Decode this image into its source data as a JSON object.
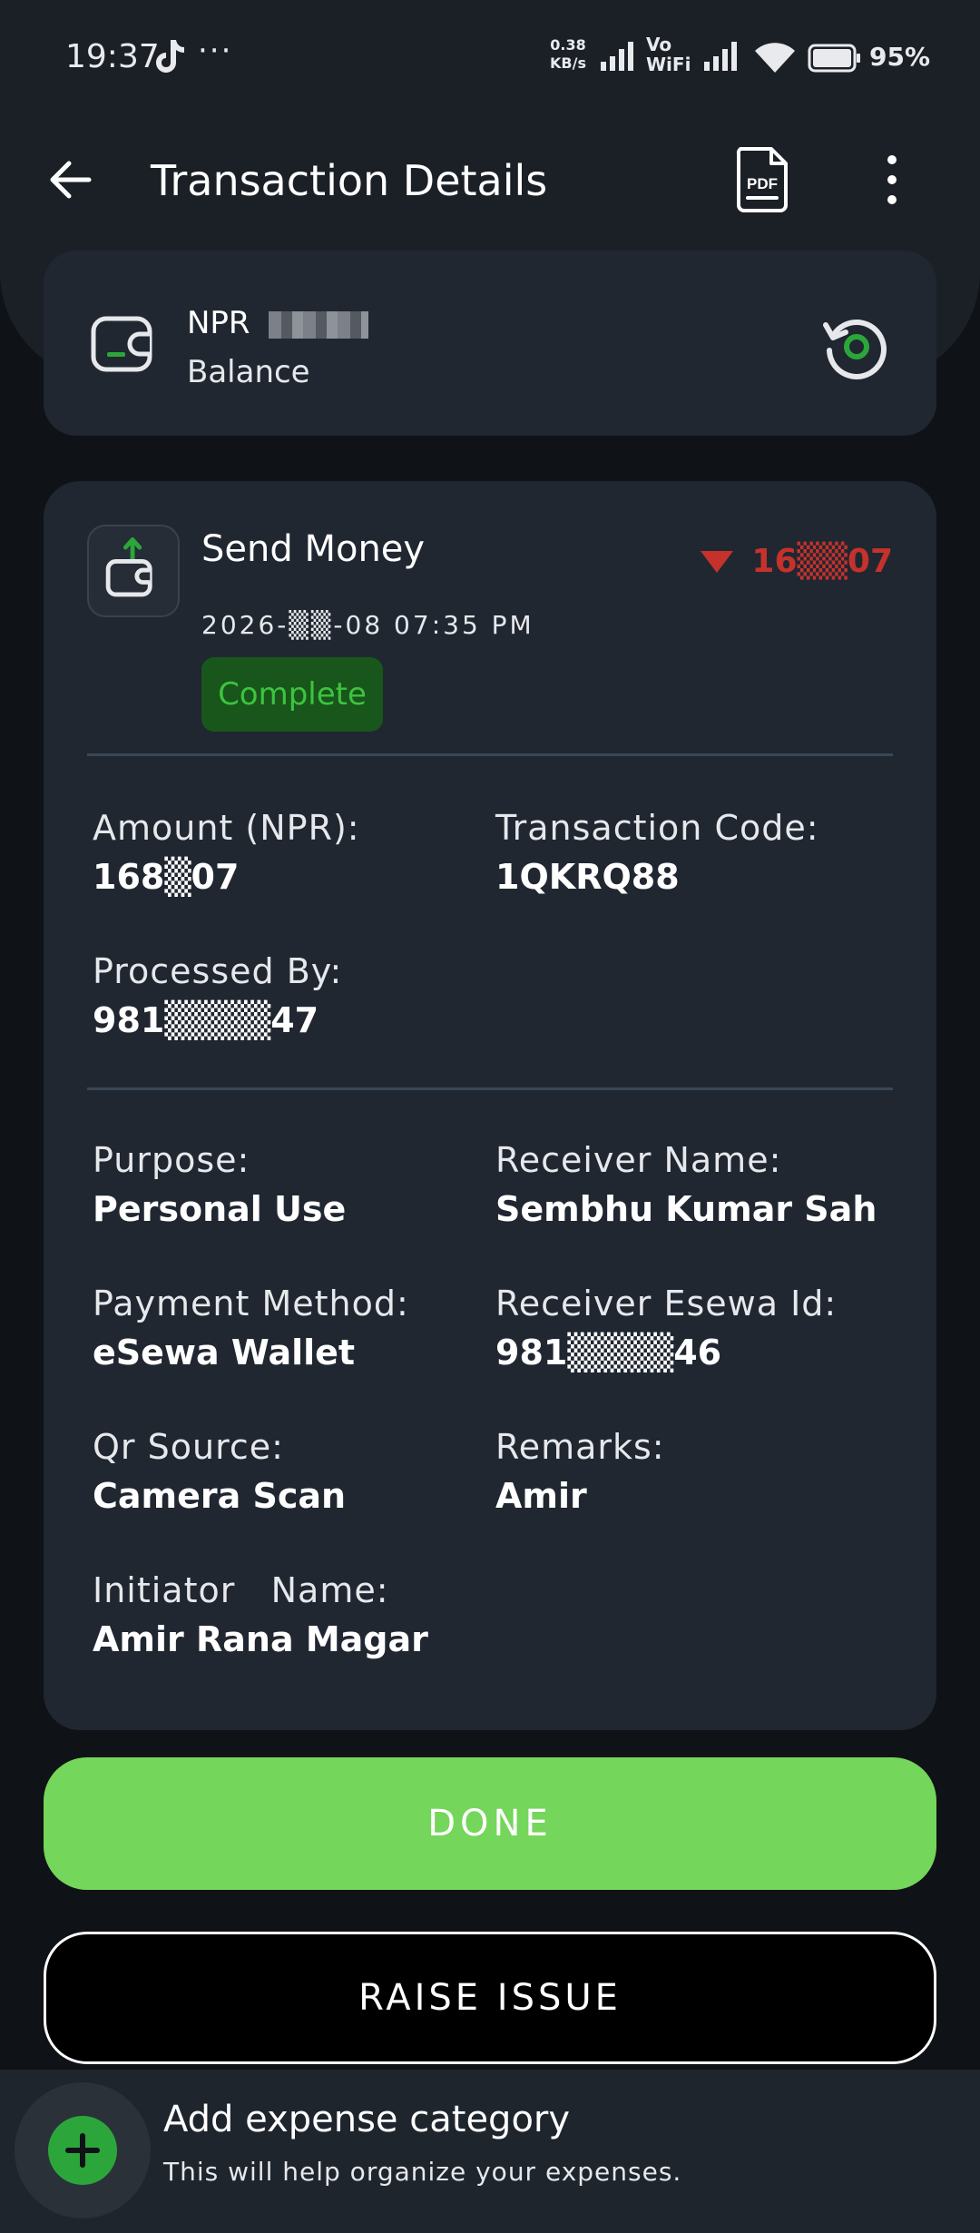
{
  "status_bar": {
    "time": "19:37",
    "dots": "···",
    "speed_value": "0.38",
    "speed_unit": "KB/s",
    "vowifi_top": "Vo",
    "vowifi_bottom": "WiFi",
    "battery_pct": "95%"
  },
  "header": {
    "title": "Transaction Details",
    "pdf_label": "PDF"
  },
  "balance": {
    "currency": "NPR",
    "label": "Balance"
  },
  "transaction": {
    "type": "Send Money",
    "amount_display": "16▒▒07",
    "date_display": "2026-▒▒-08 07:35 PM",
    "status": "Complete",
    "amount_color": "#c5322b",
    "status_color": "#3cc43f"
  },
  "fields": {
    "amount_label": "Amount (NPR):",
    "amount_value": "168▒07",
    "code_label": "Transaction Code:",
    "code_value": "1QKRQ88",
    "processed_label": "Processed By:",
    "processed_value": "981▒▒▒▒47",
    "purpose_label": "Purpose:",
    "purpose_value": "Personal Use",
    "receiver_label": "Receiver Name:",
    "receiver_value": "Sembhu Kumar Sah",
    "method_label": "Payment Method:",
    "method_value": "eSewa Wallet",
    "esewa_id_label": "Receiver Esewa Id:",
    "esewa_id_value": "981▒▒▒▒46",
    "qr_label": "Qr Source:",
    "qr_value": "Camera Scan",
    "remarks_label": "Remarks:",
    "remarks_value": "Amir",
    "initiator_label": "Initiator   Name:",
    "initiator_value": "Amir Rana Magar"
  },
  "actions": {
    "done_label": "DONE",
    "raise_label": "RAISE ISSUE",
    "done_color": "#74d65a"
  },
  "expense_prompt": {
    "title": "Add expense category",
    "subtitle": "This will help organize your expenses."
  },
  "icons": [
    "back-arrow-icon",
    "pdf-icon",
    "more-vertical-icon",
    "wallet-icon",
    "refresh-icon",
    "send-money-icon",
    "add-icon"
  ]
}
